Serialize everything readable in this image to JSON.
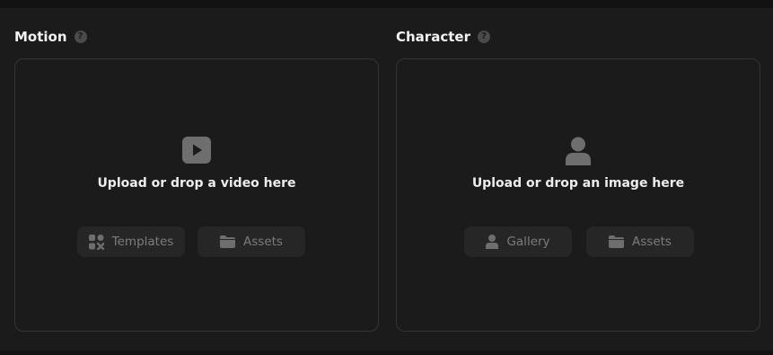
{
  "motion": {
    "title": "Motion",
    "help_glyph": "?",
    "upload_text": "Upload or drop a video here",
    "upload_icon": "play-video-icon",
    "buttons": [
      {
        "label": "Templates",
        "icon": "templates-grid-icon"
      },
      {
        "label": "Assets",
        "icon": "folder-icon"
      }
    ]
  },
  "character": {
    "title": "Character",
    "help_glyph": "?",
    "upload_text": "Upload or drop an image here",
    "upload_icon": "person-icon",
    "buttons": [
      {
        "label": "Gallery",
        "icon": "person-icon"
      },
      {
        "label": "Assets",
        "icon": "folder-icon"
      }
    ]
  },
  "colors": {
    "background": "#1b1b1b",
    "border": "#343434",
    "button_bg": "#262626",
    "button_text": "#7c7c7c",
    "icon_gray": "#6e6e6e"
  }
}
